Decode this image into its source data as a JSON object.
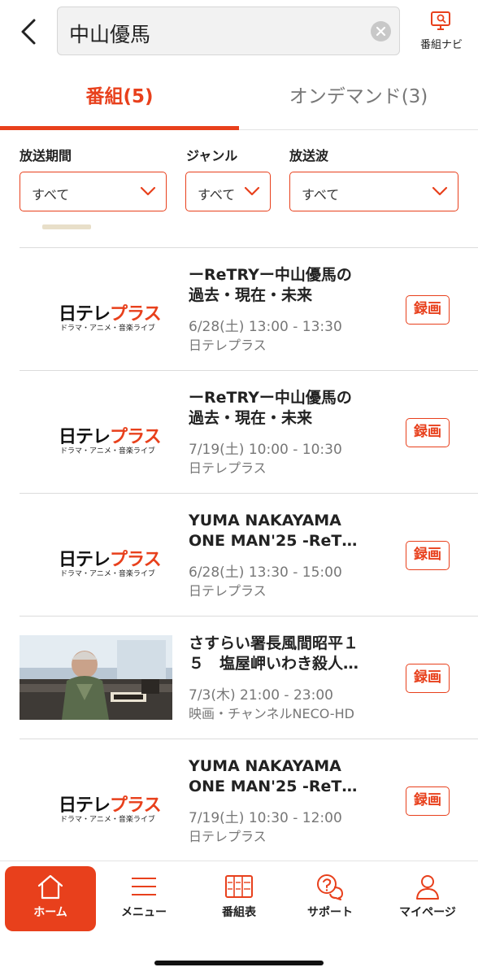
{
  "header": {
    "search_value": "中山優馬",
    "navi_label": "番組ナビ"
  },
  "tabs": [
    {
      "label": "番組(5)",
      "active": true
    },
    {
      "label": "オンデマンド(3)",
      "active": false
    }
  ],
  "filters": [
    {
      "label": "放送期間",
      "value": "すべて"
    },
    {
      "label": "ジャンル",
      "value": "すべて"
    },
    {
      "label": "放送波",
      "value": "すべて"
    }
  ],
  "logo": {
    "top_black": "日テレ",
    "top_red": "プラス",
    "sub": "ドラマ・アニメ・音楽ライブ"
  },
  "programs": [
    {
      "title_line1": "ーReTRYー中山優馬の",
      "title_line2": "過去・現在・未来",
      "time": "6/28(土) 13:00 - 13:30",
      "channel": "日テレプラス",
      "record_label": "録画",
      "thumb": "logo"
    },
    {
      "title_line1": "ーReTRYー中山優馬の",
      "title_line2": "過去・現在・未来",
      "time": "7/19(土) 10:00 - 10:30",
      "channel": "日テレプラス",
      "record_label": "録画",
      "thumb": "logo"
    },
    {
      "title_line1": "YUMA NAKAYAMA",
      "title_line2": "ONE MAN'25 -ReT…",
      "time": "6/28(土) 13:30 - 15:00",
      "channel": "日テレプラス",
      "record_label": "録画",
      "thumb": "logo"
    },
    {
      "title_line1": "さすらい署長風間昭平１",
      "title_line2": "５　塩屋岬いわき殺人…",
      "time": "7/3(木) 21:00 - 23:00",
      "channel": "映画・チャンネルNECO-HD",
      "record_label": "録画",
      "thumb": "photo"
    },
    {
      "title_line1": "YUMA NAKAYAMA",
      "title_line2": "ONE MAN'25 -ReT…",
      "time": "7/19(土) 10:30 - 12:00",
      "channel": "日テレプラス",
      "record_label": "録画",
      "thumb": "logo"
    }
  ],
  "bottom_nav": [
    {
      "label": "ホーム",
      "icon": "home-icon",
      "active": true
    },
    {
      "label": "メニュー",
      "icon": "menu-icon",
      "active": false
    },
    {
      "label": "番組表",
      "icon": "program-guide-icon",
      "active": false
    },
    {
      "label": "サポート",
      "icon": "support-icon",
      "active": false
    },
    {
      "label": "マイページ",
      "icon": "user-icon",
      "active": false
    }
  ],
  "colors": {
    "accent": "#e8401c",
    "muted_text": "#777777",
    "divider": "#dcdcdc"
  }
}
